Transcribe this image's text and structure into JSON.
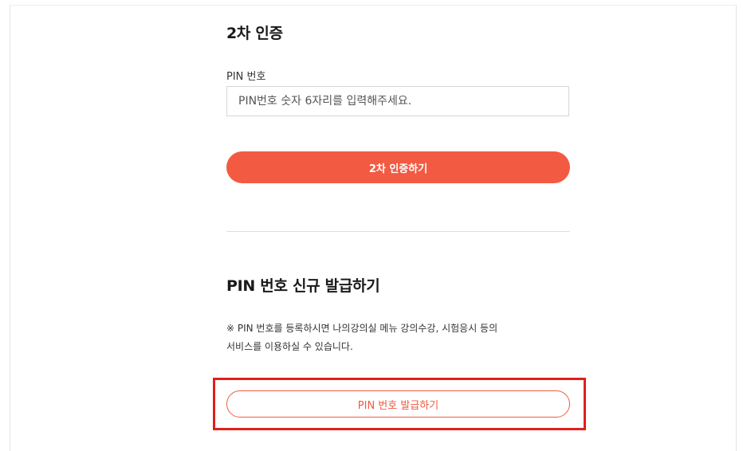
{
  "auth": {
    "title": "2차 인증",
    "pin_label": "PIN 번호",
    "pin_placeholder": "PIN번호 숫자 6자리를 입력해주세요.",
    "submit_label": "2차 인증하기"
  },
  "issue": {
    "title": "PIN 번호 신규 발급하기",
    "notice_lines": [
      "※ PIN 번호를 등록하시면 나의강의실 메뉴 강의수강, 시험응시 등의",
      "서비스를 이용하실 수 있습니다."
    ],
    "issue_button_label": "PIN 번호 발급하기"
  },
  "colors": {
    "primary": "#f25a42",
    "highlight_border": "#e0201a"
  }
}
